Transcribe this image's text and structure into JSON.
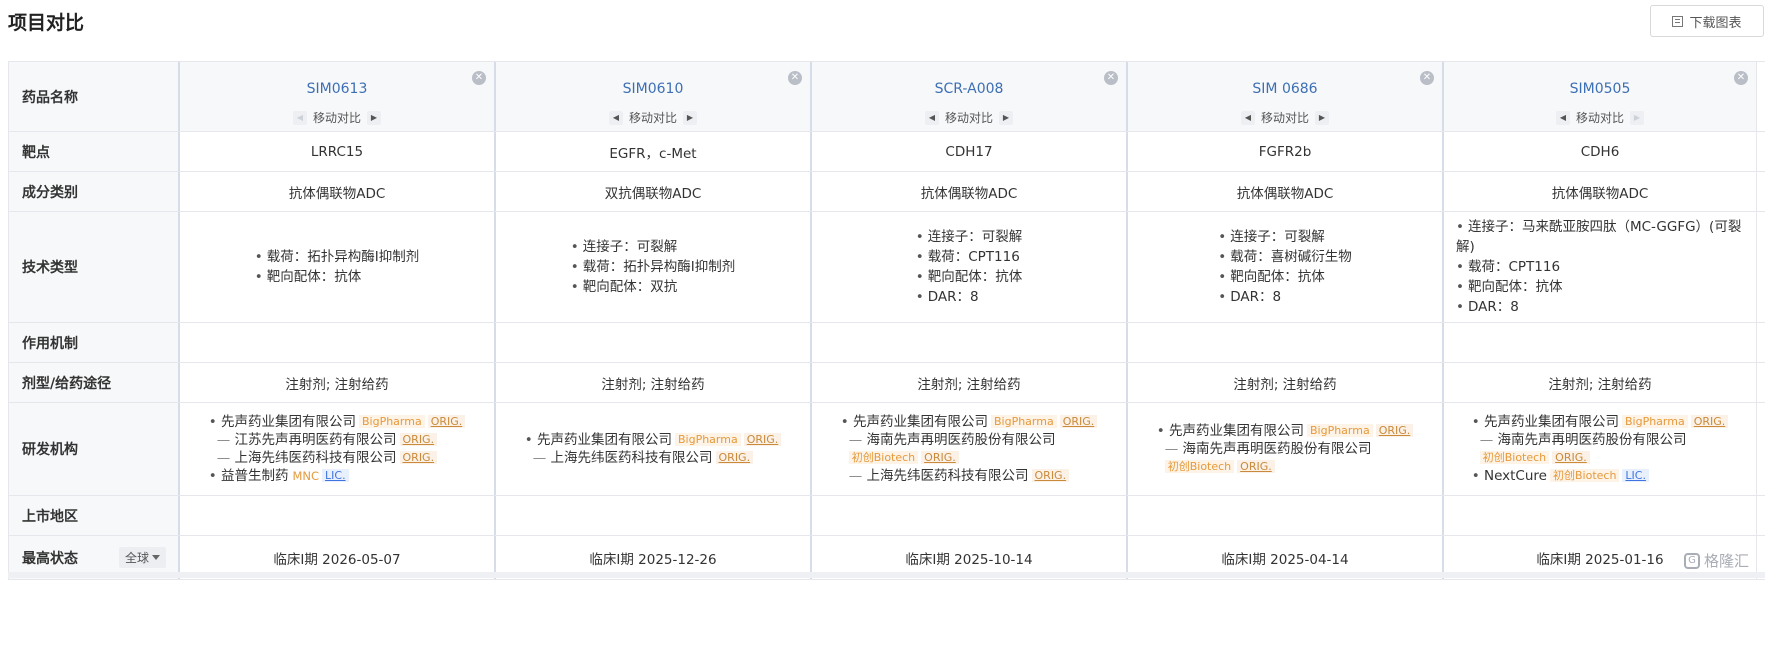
{
  "page": {
    "title": "项目对比",
    "download_label": "下载图表",
    "watermark": "格隆汇"
  },
  "labels": {
    "drug_name": "药品名称",
    "target": "靶点",
    "category": "成分类别",
    "tech": "技术类型",
    "mechanism": "作用机制",
    "route": "剂型/给药途径",
    "org": "研发机构",
    "region": "上市地区",
    "status": "最高状态",
    "status_scope": "全球"
  },
  "move_label": "移动对比",
  "drugs": [
    {
      "name": "SIM0613",
      "target": "LRRC15",
      "category": "抗体偶联物ADC",
      "tech": [
        "载荷：拓扑异构酶I抑制剂",
        "靶向配体：抗体"
      ],
      "route": "注射剂; 注射给药",
      "status": "临床I期 2026-05-07"
    },
    {
      "name": "SIM0610",
      "target": "EGFR，c-Met",
      "category": "双抗偶联物ADC",
      "tech": [
        "连接子：可裂解",
        "载荷：拓扑异构酶I抑制剂",
        "靶向配体：双抗"
      ],
      "route": "注射剂; 注射给药",
      "status": "临床I期 2025-12-26"
    },
    {
      "name": "SCR-A008",
      "target": "CDH17",
      "category": "抗体偶联物ADC",
      "tech": [
        "连接子：可裂解",
        "载荷：CPT116",
        "靶向配体：抗体",
        "DAR：8"
      ],
      "route": "注射剂; 注射给药",
      "status": "临床I期 2025-10-14"
    },
    {
      "name": "SIM 0686",
      "target": "FGFR2b",
      "category": "抗体偶联物ADC",
      "tech": [
        "连接子：可裂解",
        "载荷：喜树碱衍生物",
        "靶向配体：抗体",
        "DAR：8"
      ],
      "route": "注射剂; 注射给药",
      "status": "临床I期 2025-04-14"
    },
    {
      "name": "SIM0505",
      "target": "CDH6",
      "category": "抗体偶联物ADC",
      "tech": [
        "连接子：马来酰亚胺四肽（MC-GGFG）(可裂解)",
        "载荷：CPT116",
        "靶向配体：抗体",
        "DAR：8"
      ],
      "route": "注射剂; 注射给药",
      "status": "临床I期 2025-01-16"
    }
  ],
  "orgs": {
    "simcere_group": "先声药业集团有限公司",
    "jiangsu_simcere": "江苏先声再明医药有限公司",
    "shanghai_xianwei": "上海先纬医药科技有限公司",
    "yipu": "益普生制药",
    "hainan_simcere": "海南先声再明医药股份有限公司",
    "nextcure": "NextCure"
  },
  "tags": {
    "bigpharma": "BigPharma",
    "orig": "ORIG.",
    "mnc": "MNC",
    "lic": "LIC.",
    "biotech": "初创Biotech"
  }
}
